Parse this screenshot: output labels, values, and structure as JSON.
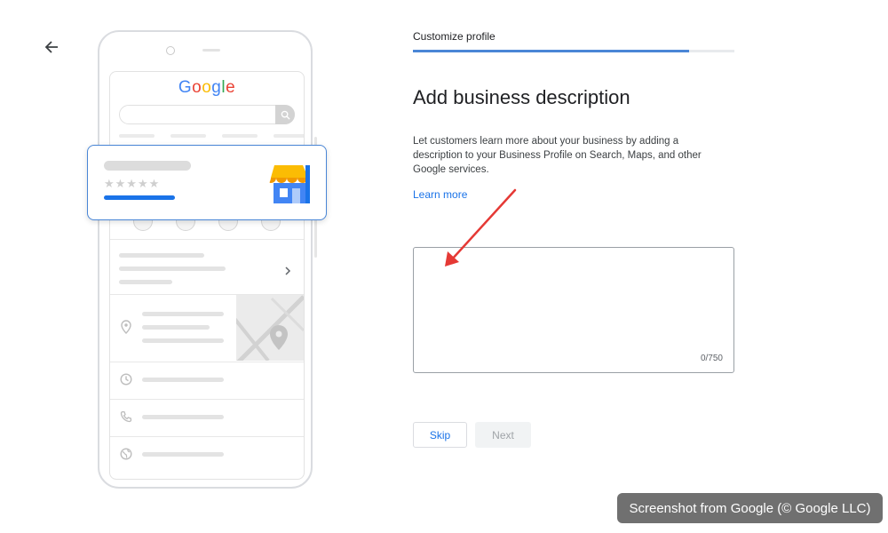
{
  "header": {
    "step_label": "Customize profile",
    "progress_fraction": 0.86
  },
  "illustration": {
    "logo_letters": [
      "G",
      "o",
      "o",
      "g",
      "l",
      "e"
    ],
    "stars": "★★★★★"
  },
  "form": {
    "heading": "Add business description",
    "description": "Let customers learn more about your business by adding a description to your Business Profile on Search, Maps, and other Google services.",
    "learn_more_label": "Learn more",
    "input_value": "",
    "char_count": "0/750"
  },
  "actions": {
    "skip_label": "Skip",
    "next_label": "Next"
  },
  "watermark": "Screenshot from Google (© Google LLC)",
  "colors": {
    "accent": "#1a73e8",
    "progress": "#4a86d6",
    "annotation": "#e53935"
  },
  "icons": [
    "back-arrow-icon",
    "search-icon",
    "phone-icon",
    "directions-icon",
    "save-icon",
    "share-icon",
    "chevron-right-icon",
    "location-pin-icon",
    "clock-icon",
    "globe-icon",
    "storefront-icon",
    "annotation-arrow-icon"
  ]
}
